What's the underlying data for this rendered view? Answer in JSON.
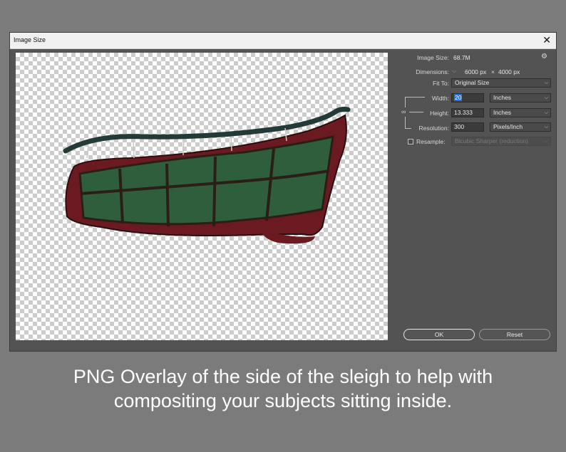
{
  "dialog": {
    "title": "Image Size",
    "close_glyph": "✕"
  },
  "info": {
    "image_size_label": "Image Size:",
    "image_size_value": "68.7M",
    "dimensions_label": "Dimensions:",
    "dimensions_w": "6000 px",
    "dimensions_x": "×",
    "dimensions_h": "4000 px",
    "fit_to_label": "Fit To:",
    "fit_to_value": "Original Size"
  },
  "fields": {
    "width_label": "Width:",
    "width_value": "20",
    "width_unit": "Inches",
    "height_label": "Height:",
    "height_value": "13.333",
    "height_unit": "Inches",
    "resolution_label": "Resolution:",
    "resolution_value": "300",
    "resolution_unit": "Pixels/Inch",
    "resample_label": "Resample:",
    "resample_checked": false,
    "resample_method": "Bicubic Sharper (reduction)"
  },
  "buttons": {
    "ok": "OK",
    "reset": "Reset"
  },
  "icons": {
    "gear": "gear-icon",
    "link": "chain-link-icon",
    "dropdown": "chevron-down-icon"
  },
  "caption": {
    "line1": "PNG Overlay of the side of the sleigh to help with",
    "line2": "compositing your subjects sitting inside."
  }
}
